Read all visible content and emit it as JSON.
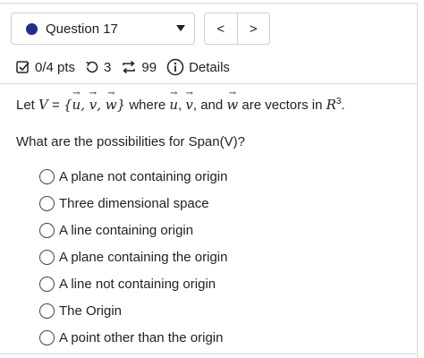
{
  "header": {
    "question_label": "Question 17",
    "prev_symbol": "<",
    "next_symbol": ">"
  },
  "meta": {
    "score": "0/4 pts",
    "attempts": "3",
    "submissions": "99",
    "details": "Details"
  },
  "prompt": {
    "lead": "Let",
    "set_name": "V",
    "equals": " = ",
    "vec_u": "u",
    "vec_v": "v",
    "vec_w": "w",
    "where": " where ",
    "and": ", and ",
    "tail": " are vectors in ",
    "space": "R",
    "exponent": "3",
    "period": "."
  },
  "question_text": "What are the possibilities for Span(V)?",
  "options": [
    "A plane not containing origin",
    "Three dimensional space",
    "A line containing origin",
    "A plane containing the origin",
    "A line not containing origin",
    "The Origin",
    "A point other than the origin"
  ],
  "colors": {
    "question_dot": "#1f2f8f",
    "border": "#cfcfcf",
    "text": "#222222"
  }
}
